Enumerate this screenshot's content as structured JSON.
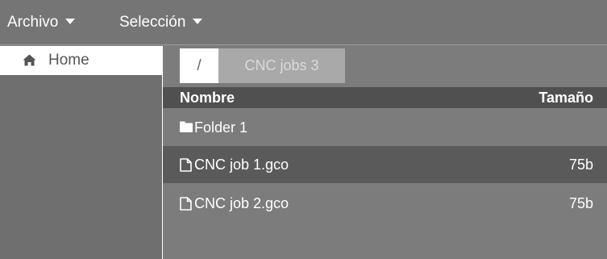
{
  "menubar": {
    "file_label": "Archivo",
    "selection_label": "Selección"
  },
  "sidebar": {
    "items": [
      {
        "label": "Home",
        "icon": "home-icon"
      }
    ]
  },
  "breadcrumb": {
    "root": "/",
    "current": "CNC jobs 3"
  },
  "table": {
    "headers": {
      "name": "Nombre",
      "size": "Tamaño"
    },
    "rows": [
      {
        "type": "folder",
        "icon": "folder-icon",
        "name": "Folder 1",
        "size": ""
      },
      {
        "type": "file",
        "icon": "file-icon",
        "name": "CNC job 1.gco",
        "size": "75b",
        "selected": true
      },
      {
        "type": "file",
        "icon": "file-icon",
        "name": "CNC job 2.gco",
        "size": "75b"
      }
    ]
  },
  "colors": {
    "menubar": "#757575",
    "sidebar": "#6f6f6f",
    "main": "#7c7c7c",
    "table_header": "#505050",
    "selected_row": "#5a5a5a",
    "breadcrumb_folder": "#a9a9a9"
  }
}
